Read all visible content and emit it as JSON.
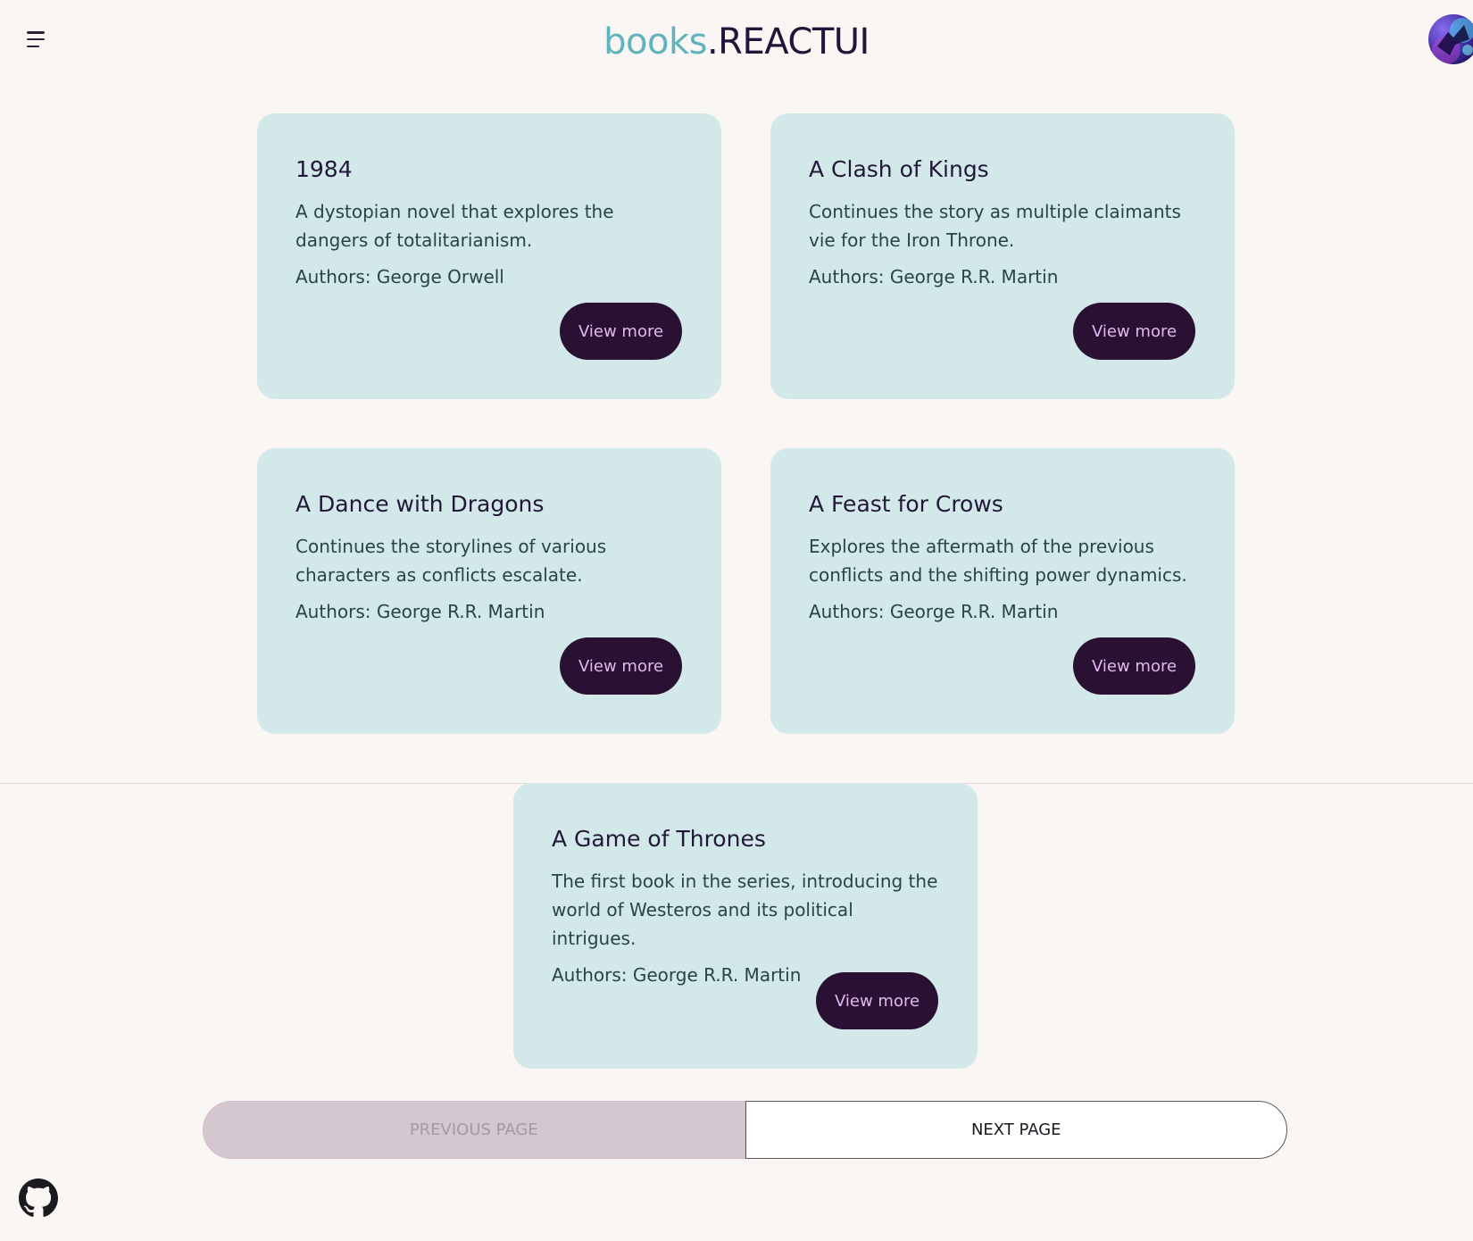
{
  "header": {
    "brand": "books",
    "suffix": ".REACTUI"
  },
  "books": [
    {
      "title": "1984",
      "description": "A dystopian novel that explores the dangers of totalitarianism.",
      "authors": "Authors: George Orwell",
      "button": "View more"
    },
    {
      "title": "A Clash of Kings",
      "description": "Continues the story as multiple claimants vie for the Iron Throne.",
      "authors": "Authors: George R.R. Martin",
      "button": "View more"
    },
    {
      "title": "A Dance with Dragons",
      "description": "Continues the storylines of various characters as conflicts escalate.",
      "authors": "Authors: George R.R. Martin",
      "button": "View more"
    },
    {
      "title": "A Feast for Crows",
      "description": "Explores the aftermath of the previous conflicts and the shifting power dynamics.",
      "authors": "Authors: George R.R. Martin",
      "button": "View more"
    },
    {
      "title": "A Game of Thrones",
      "description": "The first book in the series, introducing the world of Westeros and its political intrigues.",
      "authors": "Authors: George R.R. Martin",
      "button": "View more"
    }
  ],
  "pagination": {
    "previous": "PREVIOUS PAGE",
    "next": "NEXT PAGE"
  },
  "icons": {
    "menu": "menu-icon",
    "avatar": "avatar",
    "github": "github-icon"
  },
  "colors": {
    "brand": "#5fb3bd",
    "card_bg": "#d3e9e9",
    "button_bg": "#2a1033",
    "button_text": "#e2b9ef",
    "page_bg": "#faf6f4"
  }
}
